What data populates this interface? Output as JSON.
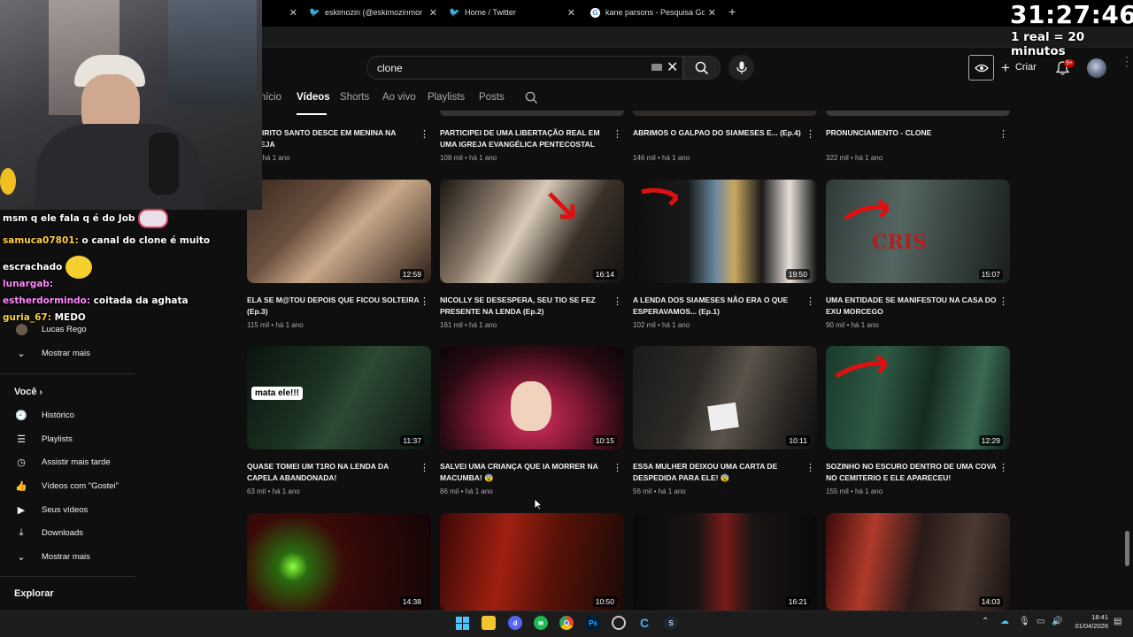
{
  "browser": {
    "tabs": [
      {
        "title": "eskimozin (@eskimozinmorreu",
        "icon": "twitter-icon"
      },
      {
        "title": "Home / Twitter",
        "icon": "twitter-icon"
      },
      {
        "title": "kane parsons - Pesquisa Google",
        "icon": "google-icon"
      }
    ]
  },
  "header": {
    "search_value": "clone",
    "create_label": "Criar",
    "notif_badge": "9+"
  },
  "channel_tabs": [
    "Início",
    "Vídeos",
    "Shorts",
    "Ao vivo",
    "Playlists",
    "Posts"
  ],
  "sidebar": {
    "subs_item": "Lucas Rego",
    "show_more_1": "Mostrar mais",
    "you_heading": "Você",
    "you_items": [
      {
        "label": "Histórico",
        "icon": "history-icon"
      },
      {
        "label": "Playlists",
        "icon": "playlists-icon"
      },
      {
        "label": "Assistir mais tarde",
        "icon": "watch-later-icon"
      },
      {
        "label": "Vídeos com \"Gostei\"",
        "icon": "like-icon"
      },
      {
        "label": "Seus vídeos",
        "icon": "your-videos-icon"
      },
      {
        "label": "Downloads",
        "icon": "download-icon"
      },
      {
        "label": "Mostrar mais",
        "icon": "chevron-down-icon"
      }
    ],
    "explore_heading": "Explorar"
  },
  "videos_top_row": [
    {
      "title": "ESPIRITO SANTO DESCE EM MENINA NA IGREJA",
      "meta": "mil • há 1 ano"
    },
    {
      "title": "PARTICIPEI DE UMA LIBERTAÇÃO REAL EM UMA IGREJA EVANGÉLICA PENTECOSTAL",
      "meta": "108 mil • há 1 ano"
    },
    {
      "title": "ABRIMOS O GALPAO DO SIAMESES E... (Ep.4)",
      "meta": "146 mil • há 1 ano"
    },
    {
      "title": "PRONUNCIAMENTO - CLONE",
      "meta": "322 mil • há 1 ano"
    }
  ],
  "videos": [
    {
      "title": "ELA SE M@TOU DEPOIS QUE FICOU SOLTEIRA (Ep.3)",
      "meta": "115 mil • há 1 ano",
      "duration": "12:59"
    },
    {
      "title": "NICOLLY SE DESESPERA, SEU TIO SE FEZ PRESENTE NA LENDA (Ep.2)",
      "meta": "161 mil • há 1 ano",
      "duration": "16:14"
    },
    {
      "title": "A LENDA DOS SIAMESES NÃO ERA O QUE ESPERAVAMOS... (Ep.1)",
      "meta": "102 mil • há 1 ano",
      "duration": "19:50"
    },
    {
      "title": "UMA ENTIDADE SE MANIFESTOU NA CASA DO EXU MORCEGO",
      "meta": "90 mil • há 1 ano",
      "duration": "15:07"
    },
    {
      "title": "QUASE TOMEI UM T1RO NA LENDA DA CAPELA ABANDONADA!",
      "meta": "63 mil • há 1 ano",
      "duration": "11:37",
      "overlay": "mata ele!!!"
    },
    {
      "title": "SALVEI UMA CRIANÇA QUE IA MORRER NA MACUMBA! 😨",
      "meta": "86 mil • há 1 ano",
      "duration": "10:15"
    },
    {
      "title": "ESSA MULHER DEIXOU UMA CARTA DE DESPEDIDA PARA ELE! 😨",
      "meta": "56 mil • há 1 ano",
      "duration": "10:11"
    },
    {
      "title": "SOZINHO NO ESCURO DENTRO DE UMA COVA NO CEMITERIO E ELE APARECEU!",
      "meta": "155 mil • há 1 ano",
      "duration": "12:29"
    },
    {
      "title": "",
      "meta": "",
      "duration": "14:38"
    },
    {
      "title": "",
      "meta": "",
      "duration": "10:50"
    },
    {
      "title": "",
      "meta": "",
      "duration": "16:21"
    },
    {
      "title": "",
      "meta": "",
      "duration": "14:03"
    }
  ],
  "overlay": {
    "timer": "31:27:46",
    "timer_sub": "1 real = 20 minutos",
    "chat": [
      {
        "user": "",
        "text": "msm q ele fala q é do Job"
      },
      {
        "user": "samuca07801:",
        "text": " o canal do clone é muito"
      },
      {
        "user": "",
        "text": "escrachado"
      },
      {
        "user": "lunargab:",
        "text": ""
      },
      {
        "user": "estherdormindo:",
        "text": " coitada da aghata"
      },
      {
        "user": "guria_67:",
        "text": " MEDO"
      }
    ]
  },
  "taskbar": {
    "time": "18:41",
    "date": "01/04/2026"
  },
  "colors": {
    "background": "#0f0f0f",
    "text_primary": "#f1f1f1",
    "text_secondary": "#aaaaaa",
    "badge_red": "#cc0000"
  }
}
